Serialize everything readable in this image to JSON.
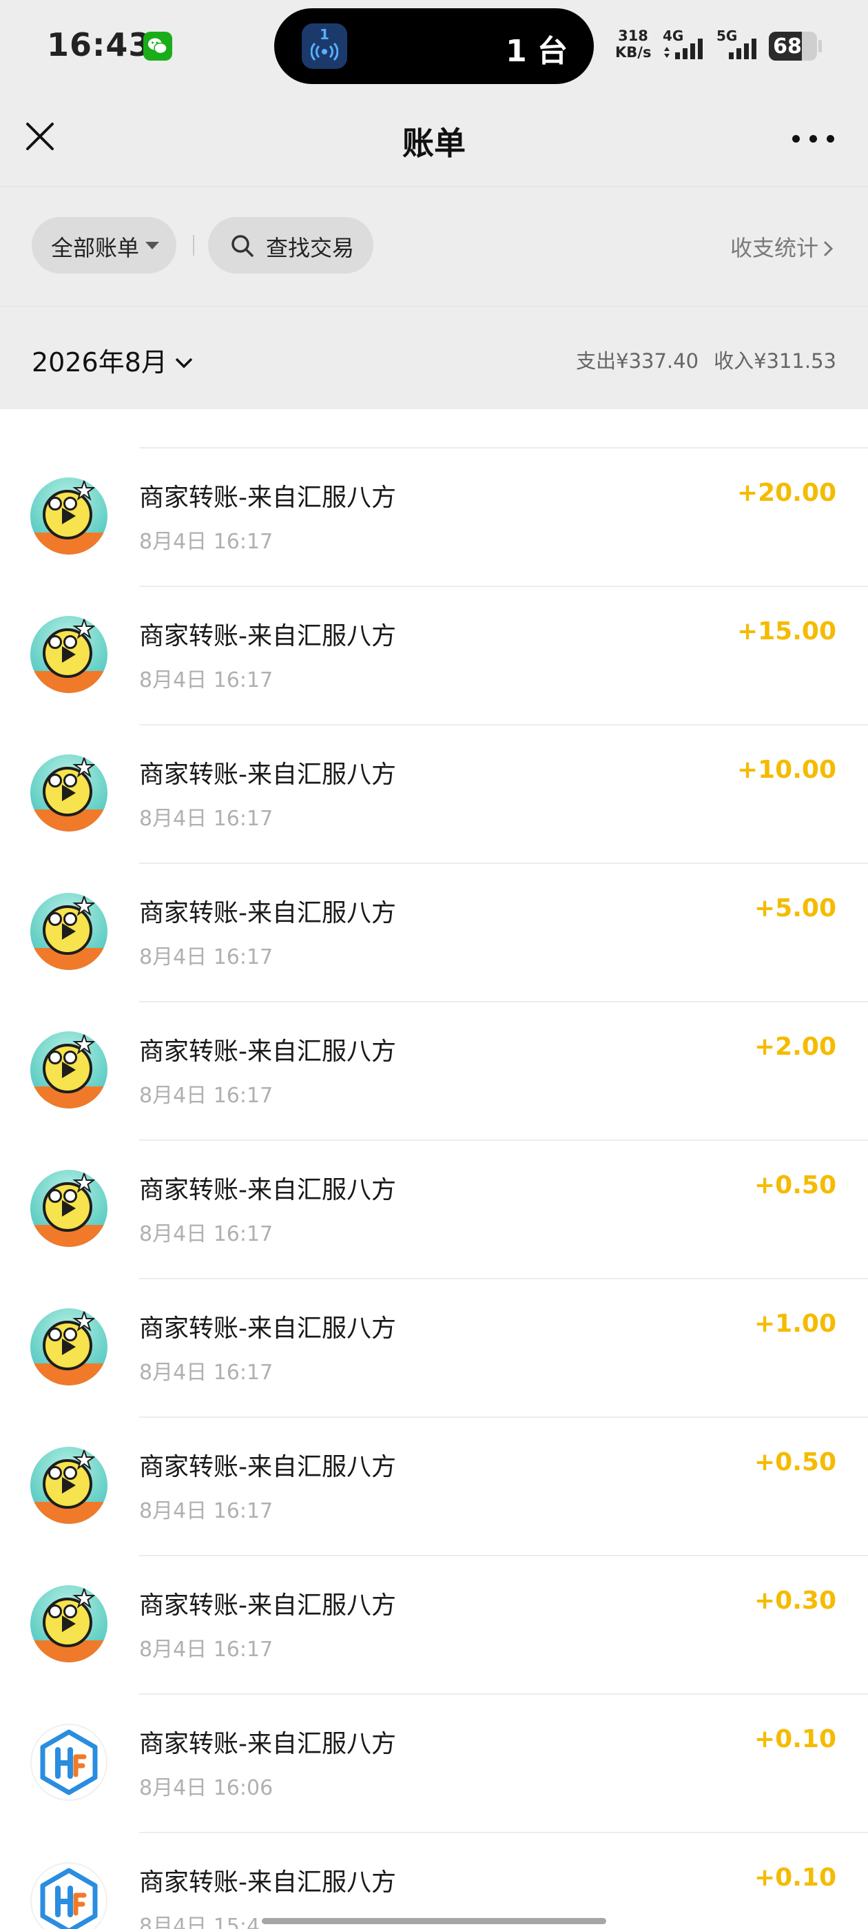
{
  "status_bar": {
    "time": "16:43",
    "island_badge": "1",
    "island_text": "1 台",
    "speed_value": "318",
    "speed_unit": "KB/s",
    "net1": "4G",
    "net2": "5G",
    "battery": "68",
    "battery_level_percent": 68
  },
  "nav": {
    "title": "账单"
  },
  "filters": {
    "all_bills": "全部账单",
    "search": "查找交易",
    "stats": "收支统计"
  },
  "month_header": {
    "month": "2026年8月",
    "expense": "支出¥337.40",
    "income": "收入¥311.53"
  },
  "colors": {
    "income_amount": "#f5bb00",
    "background_header": "#ededed"
  },
  "transactions": [
    {
      "title": "商家转账-来自汇服八方",
      "time": "8月4日 16:17",
      "amount": "+20.00",
      "avatar": "mascot"
    },
    {
      "title": "商家转账-来自汇服八方",
      "time": "8月4日 16:17",
      "amount": "+15.00",
      "avatar": "mascot"
    },
    {
      "title": "商家转账-来自汇服八方",
      "time": "8月4日 16:17",
      "amount": "+10.00",
      "avatar": "mascot"
    },
    {
      "title": "商家转账-来自汇服八方",
      "time": "8月4日 16:17",
      "amount": "+5.00",
      "avatar": "mascot"
    },
    {
      "title": "商家转账-来自汇服八方",
      "time": "8月4日 16:17",
      "amount": "+2.00",
      "avatar": "mascot"
    },
    {
      "title": "商家转账-来自汇服八方",
      "time": "8月4日 16:17",
      "amount": "+0.50",
      "avatar": "mascot"
    },
    {
      "title": "商家转账-来自汇服八方",
      "time": "8月4日 16:17",
      "amount": "+1.00",
      "avatar": "mascot"
    },
    {
      "title": "商家转账-来自汇服八方",
      "time": "8月4日 16:17",
      "amount": "+0.50",
      "avatar": "mascot"
    },
    {
      "title": "商家转账-来自汇服八方",
      "time": "8月4日 16:17",
      "amount": "+0.30",
      "avatar": "mascot"
    },
    {
      "title": "商家转账-来自汇服八方",
      "time": "8月4日 16:06",
      "amount": "+0.10",
      "avatar": "hf-logo"
    },
    {
      "title": "商家转账-来自汇服八方",
      "time": "8月4日 15:4",
      "amount": "+0.10",
      "avatar": "hf-logo"
    }
  ]
}
